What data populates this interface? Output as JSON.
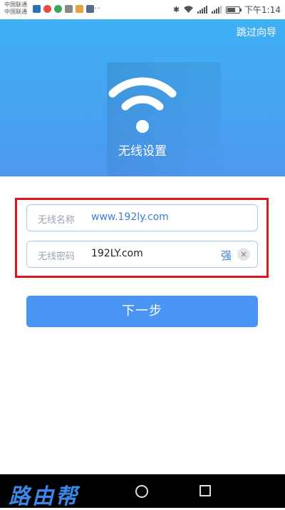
{
  "statusbar": {
    "carrier_1": "中国联通",
    "carrier_2": "中国联通",
    "more": "···",
    "time": "下午1:14"
  },
  "header": {
    "skip_label": "跳过向导",
    "title": "无线设置"
  },
  "form": {
    "ssid_label": "无线名称",
    "ssid_value": "www.192ly.com",
    "password_label": "无线密码",
    "password_value": "192LY.com",
    "strength": "强",
    "clear": "×"
  },
  "next_label": "下一步",
  "watermark": "路由帮",
  "colors": {
    "brand_blue": "#4a95f4",
    "highlight_red": "#e0161e"
  }
}
